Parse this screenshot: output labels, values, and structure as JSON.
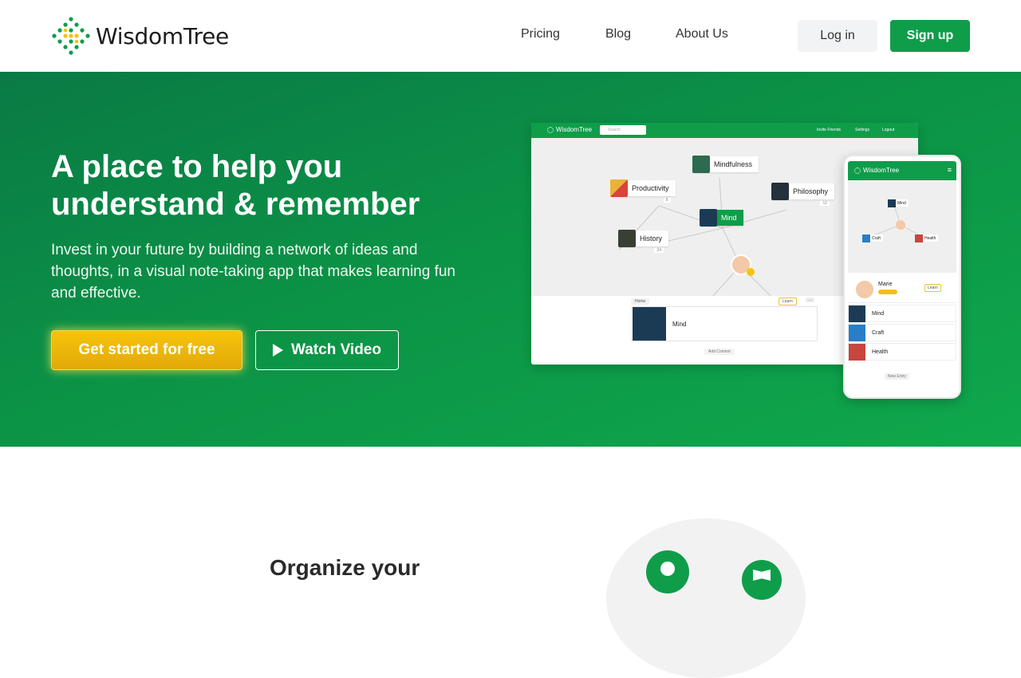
{
  "brand": {
    "name": "WisdomTree",
    "primary_color": "#0f9d4a",
    "accent_color": "#f6c40a"
  },
  "nav": {
    "links": [
      "Pricing",
      "Blog",
      "About Us"
    ],
    "login": "Log in",
    "signup": "Sign up"
  },
  "hero": {
    "title": "A place to help you understand & remember",
    "subtitle": "Invest in your future by building a network of ideas and thoughts, in a visual note-taking app that makes learning fun and effective.",
    "cta_primary": "Get started for free",
    "cta_secondary": "Watch Video"
  },
  "desktop_mock": {
    "logo": "WisdomTree",
    "search_placeholder": "Search",
    "links": [
      "Invite Friends",
      "Settings",
      "Logout"
    ],
    "nodes": [
      {
        "label": "Mindfulness"
      },
      {
        "label": "Productivity",
        "count": "8"
      },
      {
        "label": "Philosophy",
        "count": "12"
      },
      {
        "label": "Mind"
      },
      {
        "label": "History",
        "count": "24"
      }
    ],
    "breadcrumb": "Home",
    "learn": "Learn",
    "more": "...",
    "card_label": "Mind",
    "add_content": "Add Content"
  },
  "phone_mock": {
    "logo": "WisdomTree",
    "nodes": [
      "Mind",
      "Craft",
      "Health"
    ],
    "profile_name": "Marie",
    "learn": "Learn",
    "rows": [
      "Mind",
      "Craft",
      "Health"
    ],
    "new_entry": "New Entry"
  },
  "features": {
    "title": "Organize your"
  }
}
